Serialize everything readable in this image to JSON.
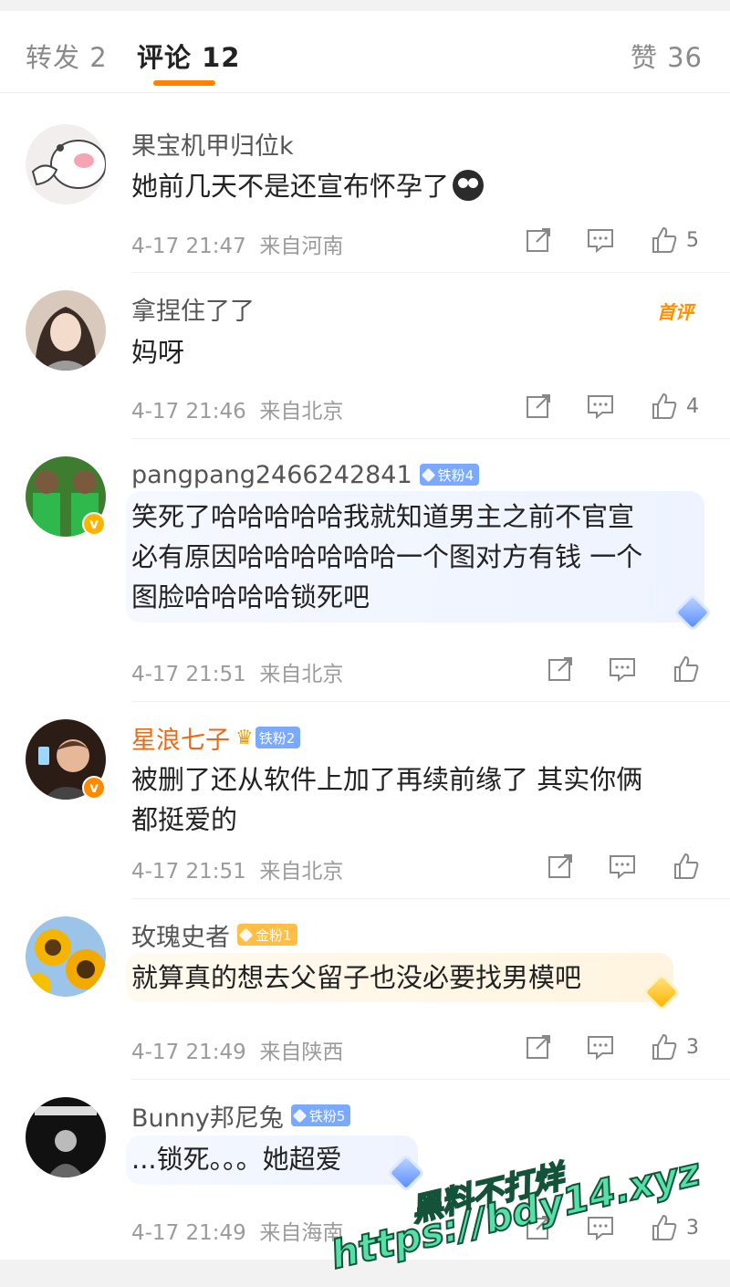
{
  "tabs": {
    "repost": "转发 2",
    "comments": "评论 12",
    "likes": "赞 36"
  },
  "comments": [
    {
      "username": "果宝机甲归位k",
      "text": "她前几天不是还宣布怀孕了",
      "emoji": "crying-emoji",
      "time": "4-17 21:47",
      "source": "来自河南",
      "likes": "5"
    },
    {
      "username": "拿捏住了了",
      "badge_first": "首评",
      "text": "妈呀",
      "time": "4-17 21:46",
      "source": "来自北京",
      "likes": "4"
    },
    {
      "username": "pangpang2466242841",
      "fan_badge": "铁粉4",
      "text_lines": [
        "笑死了哈哈哈哈哈我就知道男主之前不官宣",
        "必有原因哈哈哈哈哈哈一个图对方有钱 一个",
        "图脸哈哈哈哈锁死吧"
      ],
      "time": "4-17 21:51",
      "source": "来自北京",
      "likes": ""
    },
    {
      "username": "星浪七子",
      "fan_badge": "铁粉2",
      "text_lines": [
        "被删了还从软件上加了再续前缘了 其实你俩",
        "都挺爱的"
      ],
      "time": "4-17 21:51",
      "source": "来自北京",
      "likes": ""
    },
    {
      "username": "玫瑰史者",
      "fan_badge": "金粉1",
      "text": "就算真的想去父留子也没必要找男模吧",
      "time": "4-17 21:49",
      "source": "来自陕西",
      "likes": "3"
    },
    {
      "username": "Bunny邦尼兔",
      "fan_badge": "铁粉5",
      "text": "...锁死。。。她超爱",
      "time": "4-17 21:49",
      "source": "来自海南",
      "likes": "3"
    }
  ],
  "watermark": {
    "line1": "黑料不打烊",
    "line2": "https://bdy14.xyz"
  },
  "colors": {
    "accent": "#ff8200",
    "first_badge": "#ff8f00",
    "iron_fan": "#7aa9ff",
    "gold_fan": "#ffbf46",
    "watermark": "#55e0a8"
  }
}
